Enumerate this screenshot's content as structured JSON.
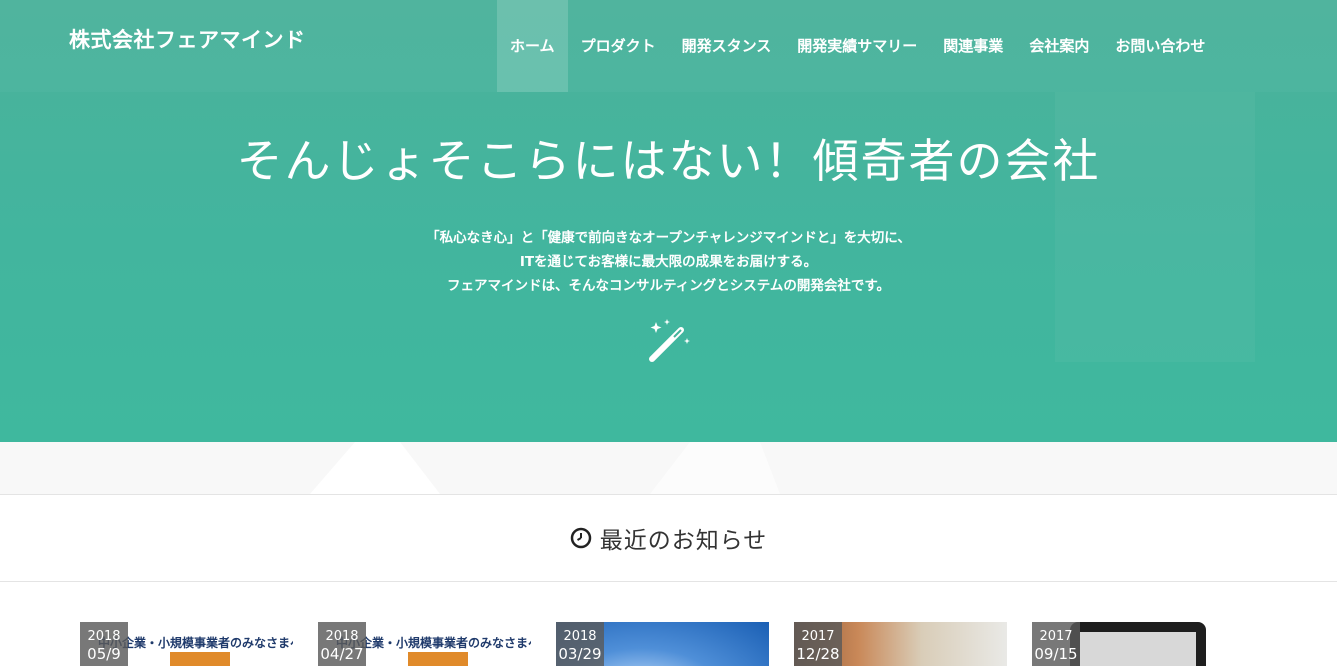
{
  "header": {
    "logo": "株式会社フェアマインド",
    "nav": [
      {
        "label": "ホーム",
        "active": true
      },
      {
        "label": "プロダクト"
      },
      {
        "label": "開発スタンス"
      },
      {
        "label": "開発実績サマリー"
      },
      {
        "label": "関連事業"
      },
      {
        "label": "会社案内"
      },
      {
        "label": "お問い合わせ"
      }
    ]
  },
  "hero": {
    "title": "そんじょそこらにはない！傾奇者の会社",
    "lines": [
      "「私心なき心」と「健康で前向きなオープンチャレンジマインドと」を大切に、",
      "ITを通じてお客様に最大限の成果をお届けする。",
      "フェアマインドは、そんなコンサルティングとシステムの開発会社です。"
    ],
    "icon": "magic-wand-icon"
  },
  "news": {
    "title": "最近のお知らせ",
    "icon": "clock-icon",
    "cards": [
      {
        "year": "2018",
        "date": "05/9",
        "thumb_text": "中小企業・小規模事業者のみなさまへ"
      },
      {
        "year": "2018",
        "date": "04/27",
        "thumb_text": "中小企業・小規模事業者のみなさまへ"
      },
      {
        "year": "2018",
        "date": "03/29",
        "thumb_text": ""
      },
      {
        "year": "2017",
        "date": "12/28",
        "thumb_text": ""
      },
      {
        "year": "2017",
        "date": "09/15",
        "thumb_text": ""
      }
    ]
  },
  "colors": {
    "hero": "#45b39c",
    "text": "#333333"
  }
}
